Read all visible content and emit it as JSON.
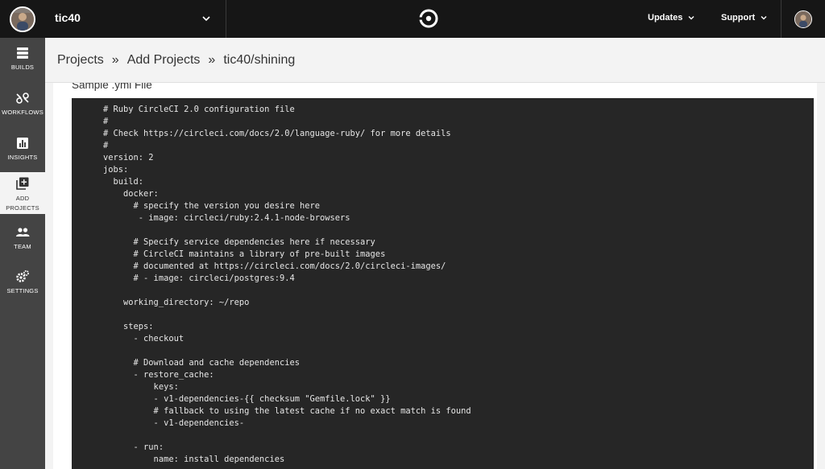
{
  "topbar": {
    "org_name": "tic40",
    "updates_label": "Updates",
    "support_label": "Support"
  },
  "sidebar": {
    "items": [
      {
        "label": "BUILDS",
        "icon": "builds-icon"
      },
      {
        "label": "WORKFLOWS",
        "icon": "workflows-icon"
      },
      {
        "label": "INSIGHTS",
        "icon": "insights-icon"
      },
      {
        "label": "ADD\nPROJECTS",
        "icon": "add-projects-icon",
        "active": true
      },
      {
        "label": "TEAM",
        "icon": "team-icon"
      },
      {
        "label": "SETTINGS",
        "icon": "settings-icon"
      }
    ]
  },
  "breadcrumb": {
    "items": [
      "Projects",
      "Add Projects",
      "tic40/shining"
    ],
    "separator": "»"
  },
  "main": {
    "section_title": "Sample .yml File",
    "code_lines": [
      "# Ruby CircleCI 2.0 configuration file",
      "#",
      "# Check https://circleci.com/docs/2.0/language-ruby/ for more details",
      "#",
      "version: 2",
      "jobs:",
      "  build:",
      "    docker:",
      "      # specify the version you desire here",
      "       - image: circleci/ruby:2.4.1-node-browsers",
      "",
      "      # Specify service dependencies here if necessary",
      "      # CircleCI maintains a library of pre-built images",
      "      # documented at https://circleci.com/docs/2.0/circleci-images/",
      "      # - image: circleci/postgres:9.4",
      "",
      "    working_directory: ~/repo",
      "",
      "    steps:",
      "      - checkout",
      "",
      "      # Download and cache dependencies",
      "      - restore_cache:",
      "          keys:",
      "          - v1-dependencies-{{ checksum \"Gemfile.lock\" }}",
      "          # fallback to using the latest cache if no exact match is found",
      "          - v1-dependencies-",
      "",
      "      - run:",
      "          name: install dependencies"
    ]
  },
  "colors": {
    "topbar_bg": "#161616",
    "sidebar_bg": "#444444",
    "code_bg": "#262626",
    "page_bg": "#f3f3f3"
  }
}
